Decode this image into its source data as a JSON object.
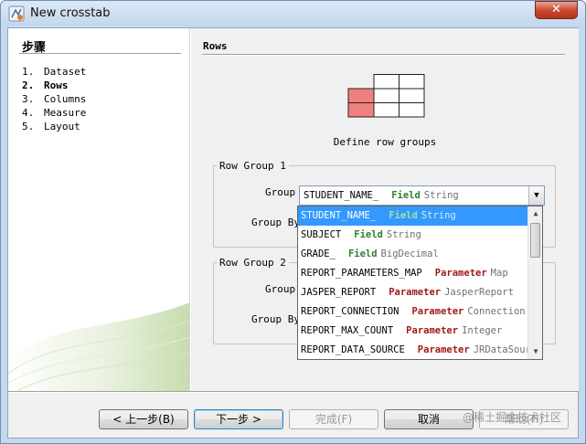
{
  "window": {
    "title": "New crosstab",
    "close_label": "✕"
  },
  "steps": {
    "title": "步骤",
    "items": [
      {
        "num": "1.",
        "label": "Dataset"
      },
      {
        "num": "2.",
        "label": "Rows",
        "active": true
      },
      {
        "num": "3.",
        "label": "Columns"
      },
      {
        "num": "4.",
        "label": "Measure"
      },
      {
        "num": "5.",
        "label": "Layout"
      }
    ]
  },
  "main": {
    "heading": "Rows",
    "define_label": "Define row groups",
    "row_group_1": {
      "legend": "Row Group 1",
      "group_label": "Group",
      "group_by_label": "Group By",
      "selected": {
        "name": "STUDENT_NAME_",
        "kind": "Field",
        "type": "String"
      }
    },
    "row_group_2": {
      "legend": "Row Group 2",
      "group_label": "Group",
      "group_by_label": "Group By"
    }
  },
  "dropdown": {
    "items": [
      {
        "name": "STUDENT_NAME_",
        "kind": "Field",
        "type": "String",
        "selected": true
      },
      {
        "name": "SUBJECT",
        "kind": "Field",
        "type": "String"
      },
      {
        "name": "GRADE_",
        "kind": "Field",
        "type": "BigDecimal"
      },
      {
        "name": "REPORT_PARAMETERS_MAP",
        "kind": "Parameter",
        "type": "Map"
      },
      {
        "name": "JASPER_REPORT",
        "kind": "Parameter",
        "type": "JasperReport"
      },
      {
        "name": "REPORT_CONNECTION",
        "kind": "Parameter",
        "type": "Connection"
      },
      {
        "name": "REPORT_MAX_COUNT",
        "kind": "Parameter",
        "type": "Integer"
      },
      {
        "name": "REPORT_DATA_SOURCE",
        "kind": "Parameter",
        "type": "JRDataSour"
      }
    ]
  },
  "buttons": {
    "back": "< 上一步(B)",
    "next": "下一步 >",
    "finish": "完成(F)",
    "cancel": "取消",
    "help": "帮助(H)"
  },
  "watermark": "@稀土掘金技术社区",
  "colors": {
    "selection": "#3399ff",
    "field_keyword": "#2e7d32",
    "parameter_keyword": "#a01919",
    "grid_highlight": "#f08080"
  }
}
